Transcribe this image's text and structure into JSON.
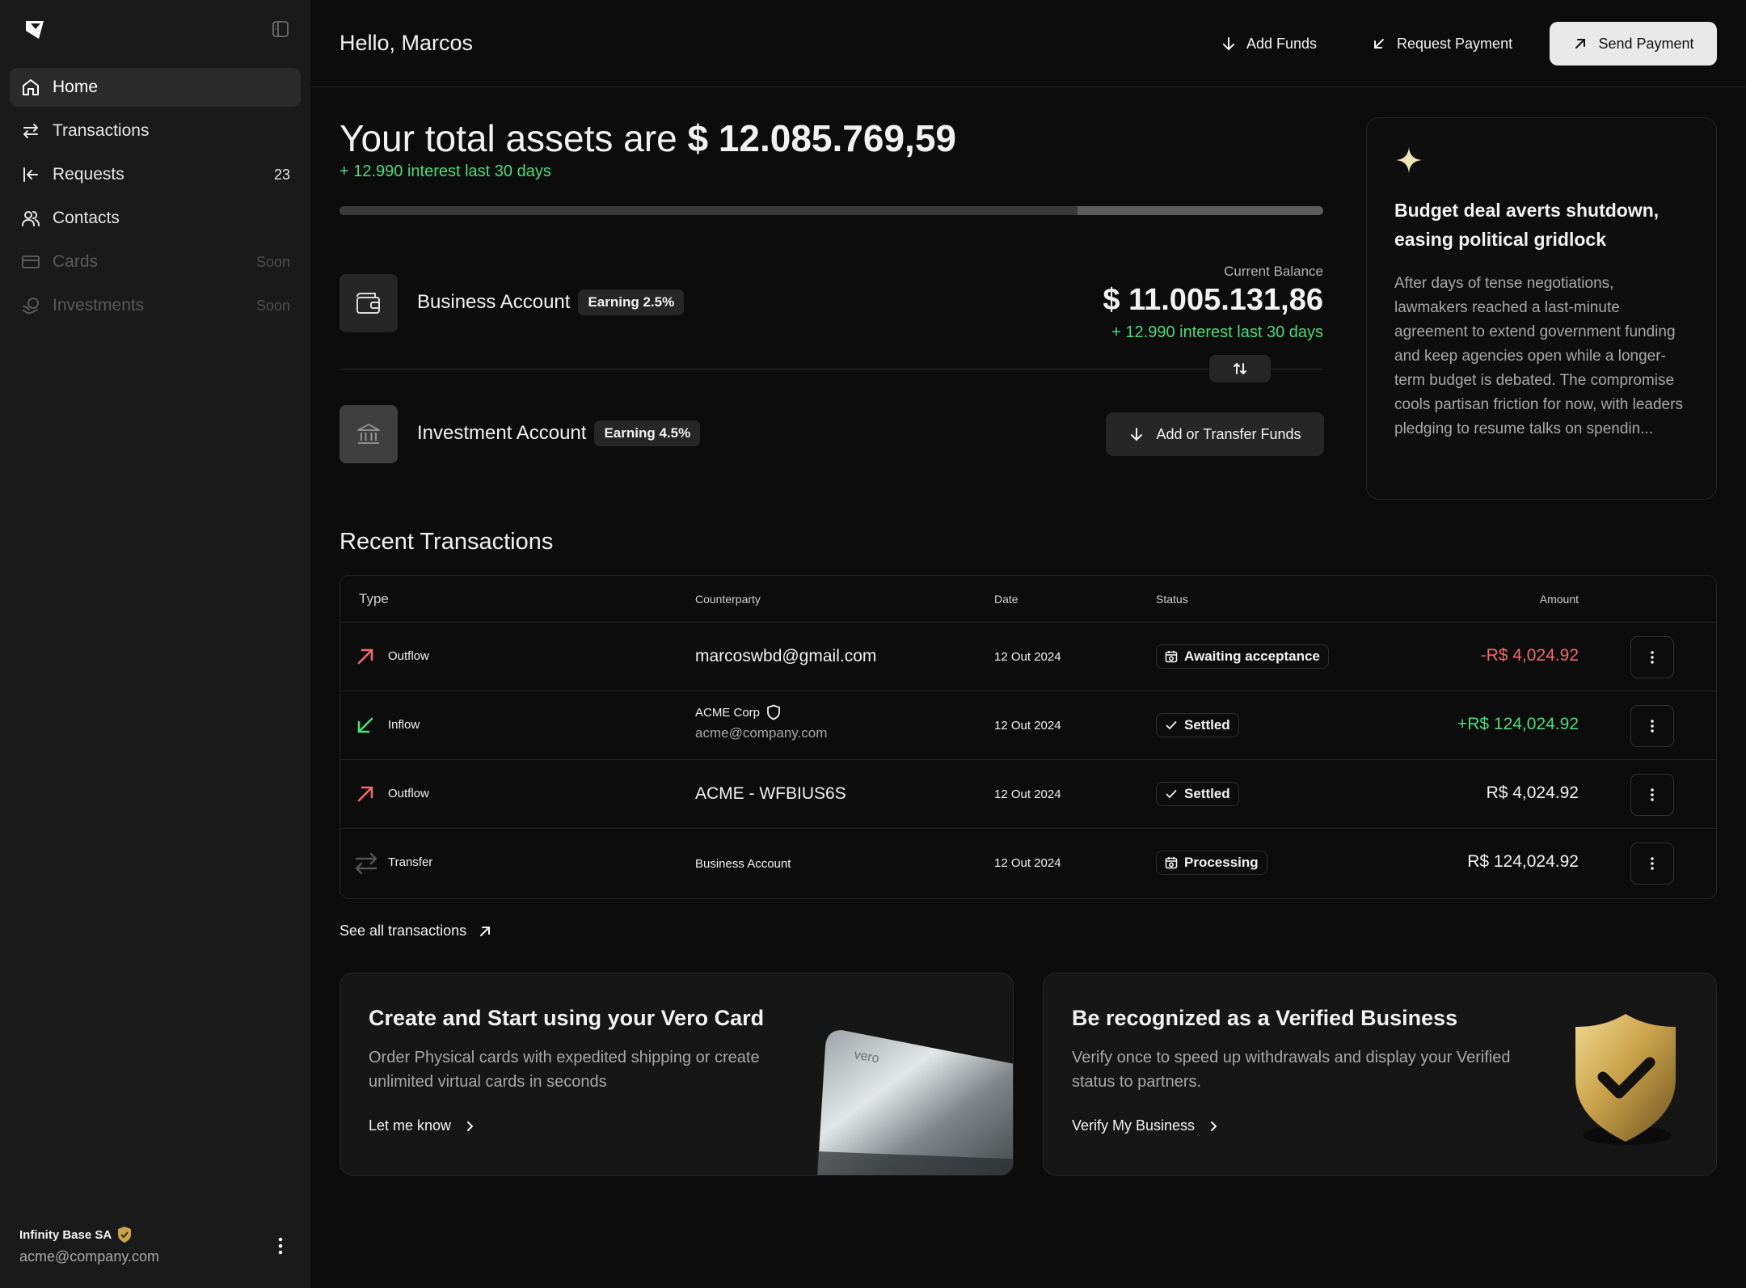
{
  "sidebar": {
    "items": [
      {
        "label": "Home",
        "icon": "home-icon",
        "meta": "",
        "state": "active"
      },
      {
        "label": "Transactions",
        "icon": "arrows-exchange-icon",
        "meta": "",
        "state": "normal"
      },
      {
        "label": "Requests",
        "icon": "arrow-left-bar-icon",
        "meta": "23",
        "state": "normal"
      },
      {
        "label": "Contacts",
        "icon": "users-icon",
        "meta": "",
        "state": "normal"
      },
      {
        "label": "Cards",
        "icon": "credit-card-icon",
        "meta": "Soon",
        "state": "disabled"
      },
      {
        "label": "Investments",
        "icon": "coins-icon",
        "meta": "Soon",
        "state": "disabled"
      }
    ],
    "org": {
      "name": "Infinity Base SA",
      "email": "acme@company.com"
    }
  },
  "header": {
    "greeting": "Hello, Marcos",
    "add_funds": "Add Funds",
    "request_payment": "Request Payment",
    "send_payment": "Send Payment"
  },
  "summary": {
    "total_prefix": "Your total assets are",
    "total_value": "$ 12.085.769,59",
    "interest": "+ 12.990 interest last 30 days",
    "progress_fraction": 0.75
  },
  "accounts": {
    "business": {
      "name": "Business Account",
      "earning": "Earning 2.5%",
      "balance_label": "Current Balance",
      "balance": "$ 11.005.131,86",
      "interest": "+ 12.990 interest last 30 days"
    },
    "investment": {
      "name": "Investment Account",
      "earning": "Earning 4.5%",
      "action": "Add or Transfer Funds"
    }
  },
  "news": {
    "title": "Budget deal averts shutdown, easing political gridlock",
    "body": "After days of tense negotiations, lawmakers reached a last-minute agreement to extend government funding and keep agencies open while a longer-term budget is debated. The compromise cools partisan friction for now, with leaders pledging to resume talks on spendin..."
  },
  "transactions": {
    "title": "Recent Transactions",
    "columns": {
      "type": "Type",
      "counterparty": "Counterparty",
      "date": "Date",
      "status": "Status",
      "amount": "Amount"
    },
    "rows": [
      {
        "type": "Outflow",
        "counterparty": "marcoswbd@gmail.com",
        "date": "12 Out 2024",
        "status": "Awaiting acceptance",
        "amount": "-R$ 4,024.92"
      },
      {
        "type": "Inflow",
        "counterparty": "ACME Corp",
        "counterparty_email": "acme@company.com",
        "date": "12 Out 2024",
        "status": "Settled",
        "amount": "+R$ 124,024.92"
      },
      {
        "type": "Outflow",
        "counterparty": "ACME - WFBIUS6S",
        "date": "12 Out 2024",
        "status": "Settled",
        "amount": "R$ 4,024.92"
      },
      {
        "type": "Transfer",
        "counterparty": "Business Account",
        "date": "12 Out 2024",
        "status": "Processing",
        "amount": "R$ 124,024.92"
      }
    ],
    "see_all": "See all transactions"
  },
  "promos": {
    "card": {
      "title": "Create and Start using your Vero Card",
      "body": "Order Physical cards with expedited shipping or create unlimited virtual cards in seconds",
      "link": "Let me know",
      "art_label": "vero"
    },
    "verify": {
      "title": "Be recognized as a Verified Business",
      "body": "Verify once to speed up withdrawals and display your Verified status to partners.",
      "link": "Verify My Business"
    }
  },
  "colors": {
    "positive": "#4ddb7a",
    "negative": "#ef6b6b",
    "gold": "#c9a24a"
  }
}
